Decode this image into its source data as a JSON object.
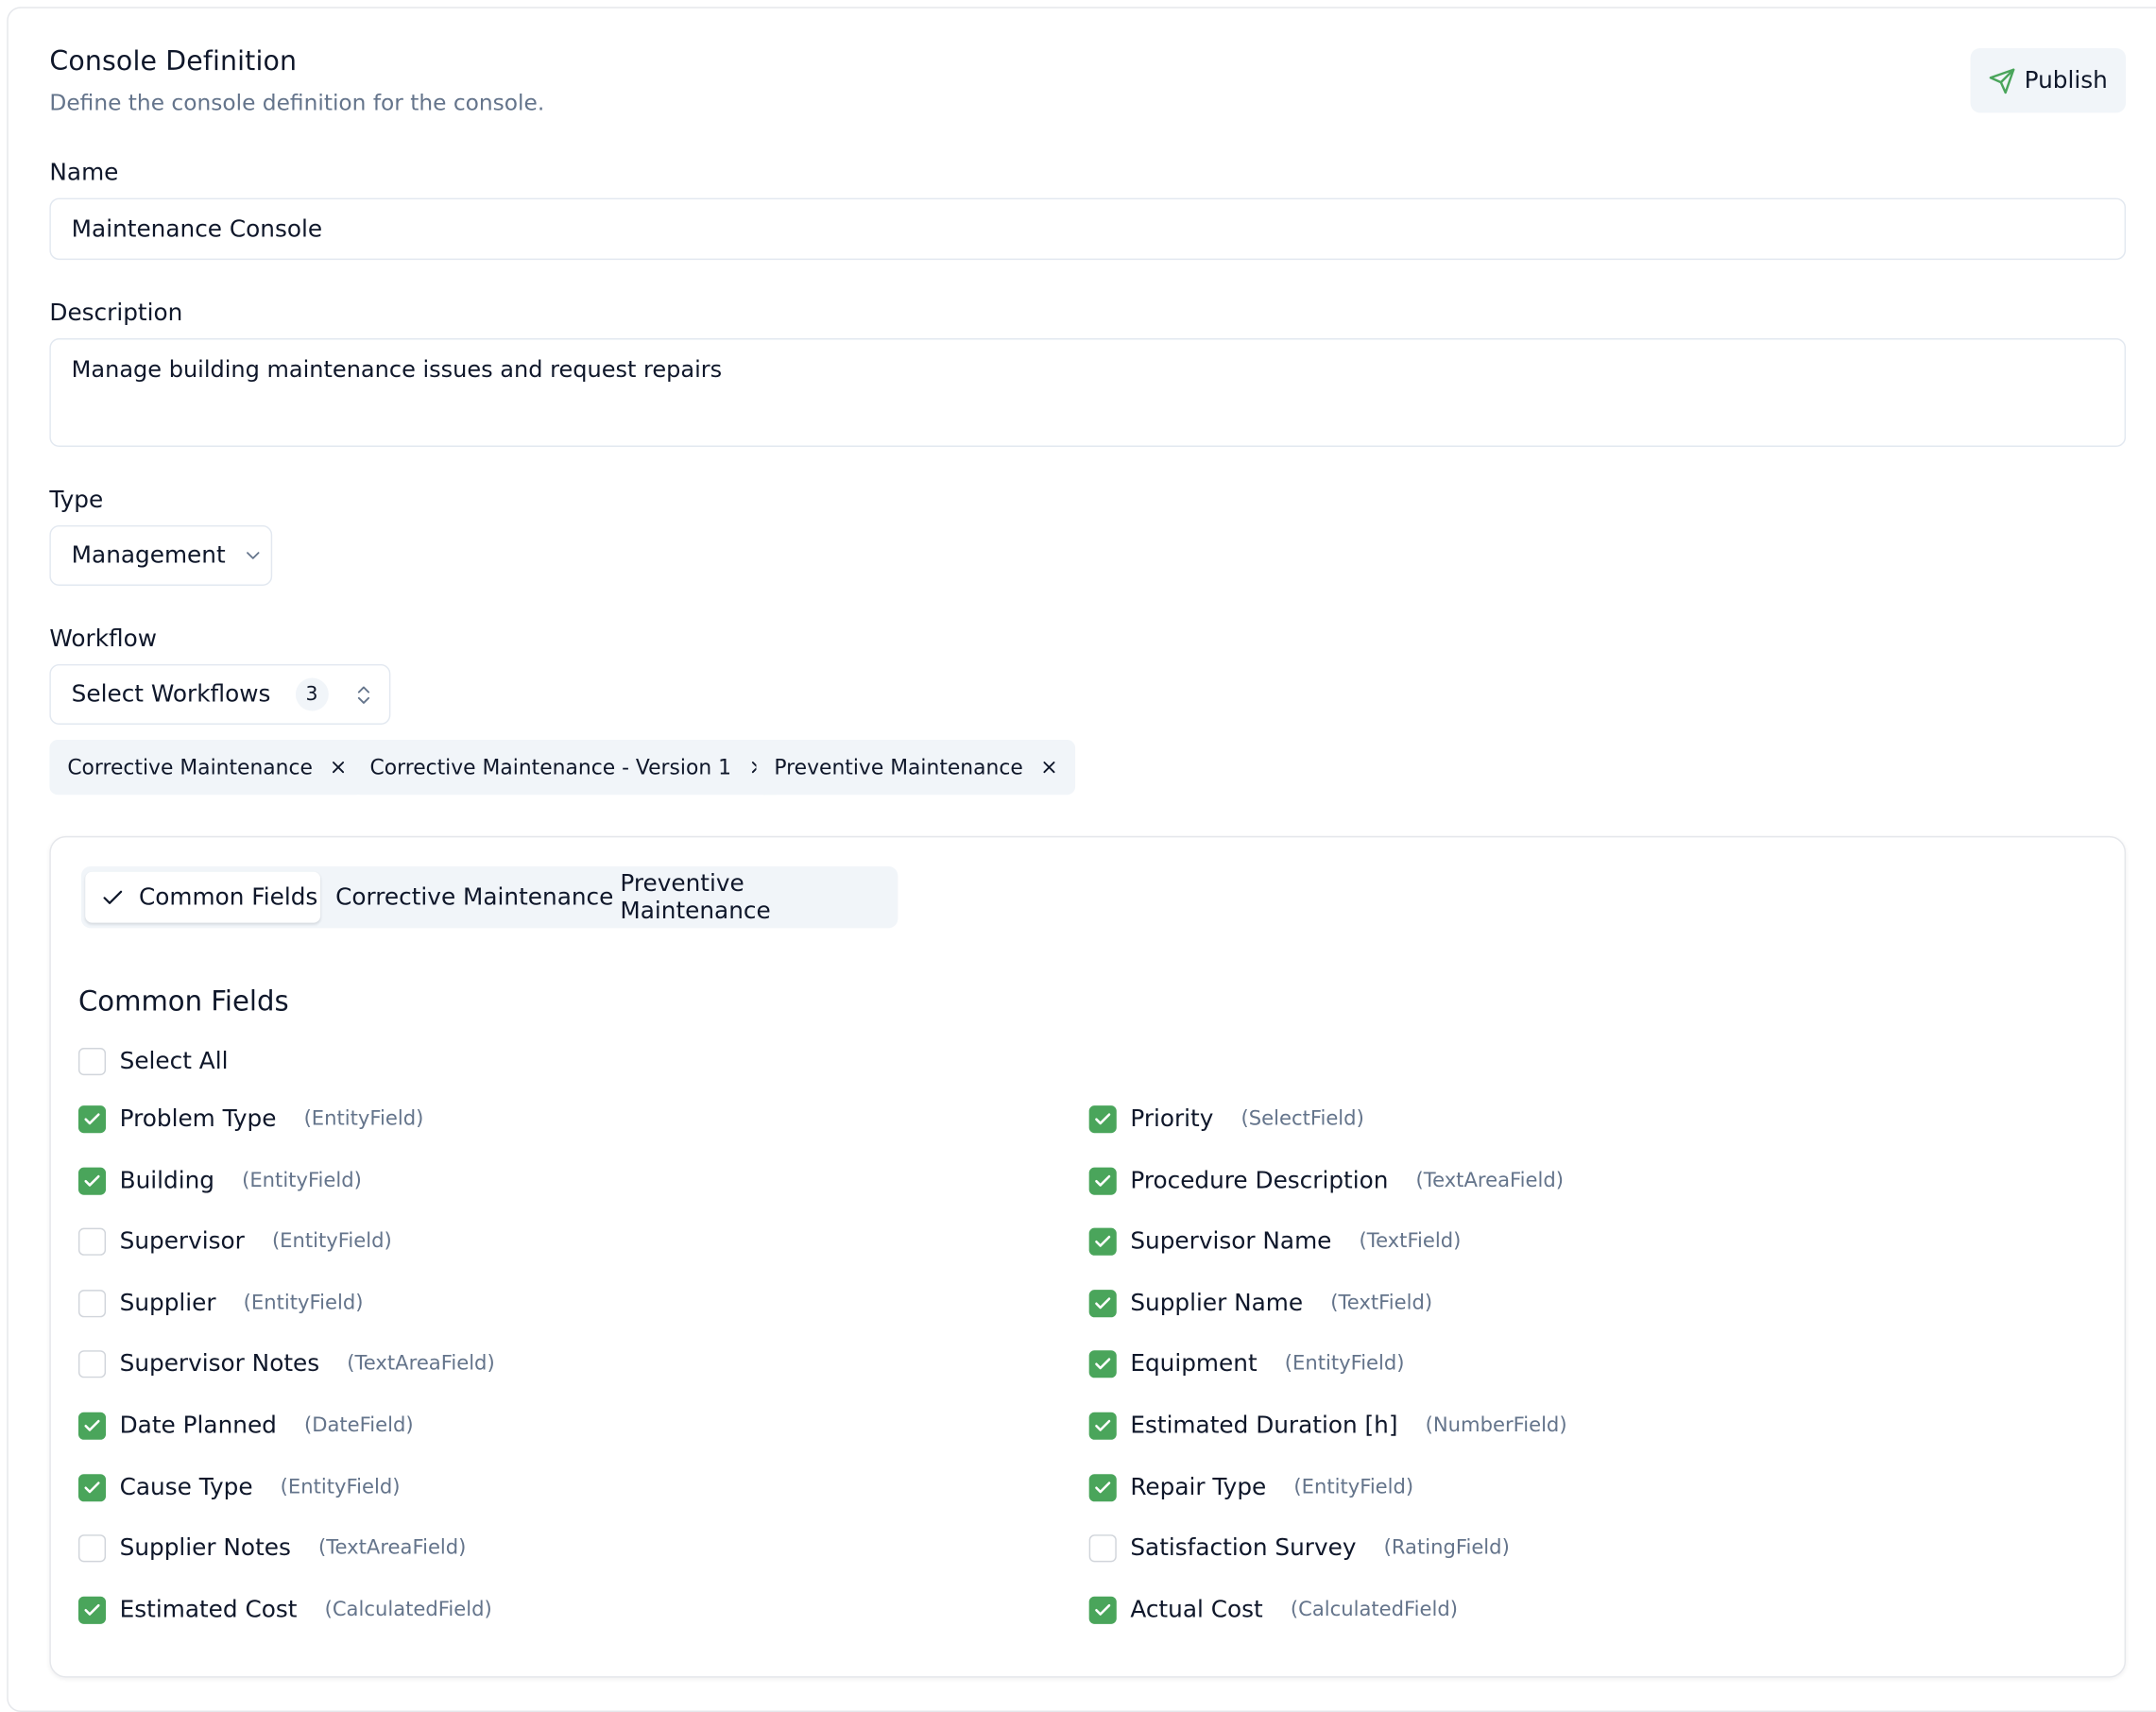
{
  "header": {
    "title": "Console Definition",
    "subtitle": "Define the console definition for the console.",
    "publish_label": "Publish"
  },
  "form": {
    "name_label": "Name",
    "name_value": "Maintenance Console",
    "description_label": "Description",
    "description_value": "Manage building maintenance issues and request repairs",
    "type_label": "Type",
    "type_value": "Management",
    "workflow_label": "Workflow",
    "workflow_select_label": "Select Workflows",
    "workflow_count": "3",
    "selected_workflows": [
      "Corrective Maintenance",
      "Corrective Maintenance - Version 1",
      "Preventive Maintenance"
    ]
  },
  "fields_panel": {
    "tabs": [
      {
        "label": "Common Fields",
        "active": true
      },
      {
        "label": "Corrective Maintenance",
        "active": false
      },
      {
        "label": "Preventive Maintenance",
        "active": false
      }
    ],
    "section_title": "Common Fields",
    "select_all_label": "Select All",
    "select_all_checked": false,
    "left_fields": [
      {
        "label": "Problem Type",
        "type": "(EntityField)",
        "checked": true
      },
      {
        "label": "Building",
        "type": "(EntityField)",
        "checked": true
      },
      {
        "label": "Supervisor",
        "type": "(EntityField)",
        "checked": false
      },
      {
        "label": "Supplier",
        "type": "(EntityField)",
        "checked": false
      },
      {
        "label": "Supervisor Notes",
        "type": "(TextAreaField)",
        "checked": false
      },
      {
        "label": "Date Planned",
        "type": "(DateField)",
        "checked": true
      },
      {
        "label": "Cause Type",
        "type": "(EntityField)",
        "checked": true
      },
      {
        "label": "Supplier Notes",
        "type": "(TextAreaField)",
        "checked": false
      },
      {
        "label": "Estimated Cost",
        "type": "(CalculatedField)",
        "checked": true
      }
    ],
    "right_fields": [
      {
        "label": "Priority",
        "type": "(SelectField)",
        "checked": true
      },
      {
        "label": "Procedure Description",
        "type": "(TextAreaField)",
        "checked": true
      },
      {
        "label": "Supervisor Name",
        "type": "(TextField)",
        "checked": true
      },
      {
        "label": "Supplier Name",
        "type": "(TextField)",
        "checked": true
      },
      {
        "label": "Equipment",
        "type": "(EntityField)",
        "checked": true
      },
      {
        "label": "Estimated Duration [h]",
        "type": "(NumberField)",
        "checked": true
      },
      {
        "label": "Repair Type",
        "type": "(EntityField)",
        "checked": true
      },
      {
        "label": "Satisfaction Survey",
        "type": "(RatingField)",
        "checked": false
      },
      {
        "label": "Actual Cost",
        "type": "(CalculatedField)",
        "checked": true
      }
    ]
  },
  "icons": {
    "publish": "send-icon",
    "type_select": "chevron-down-icon",
    "workflow_select": "chevrons-up-down-icon",
    "chip_remove": "close-icon",
    "active_tab": "check-icon",
    "checkbox_checked": "check-icon"
  },
  "colors": {
    "accent_green": "#4aa55b",
    "muted_text": "#64748b",
    "chip_background": "#f1f5f9"
  }
}
